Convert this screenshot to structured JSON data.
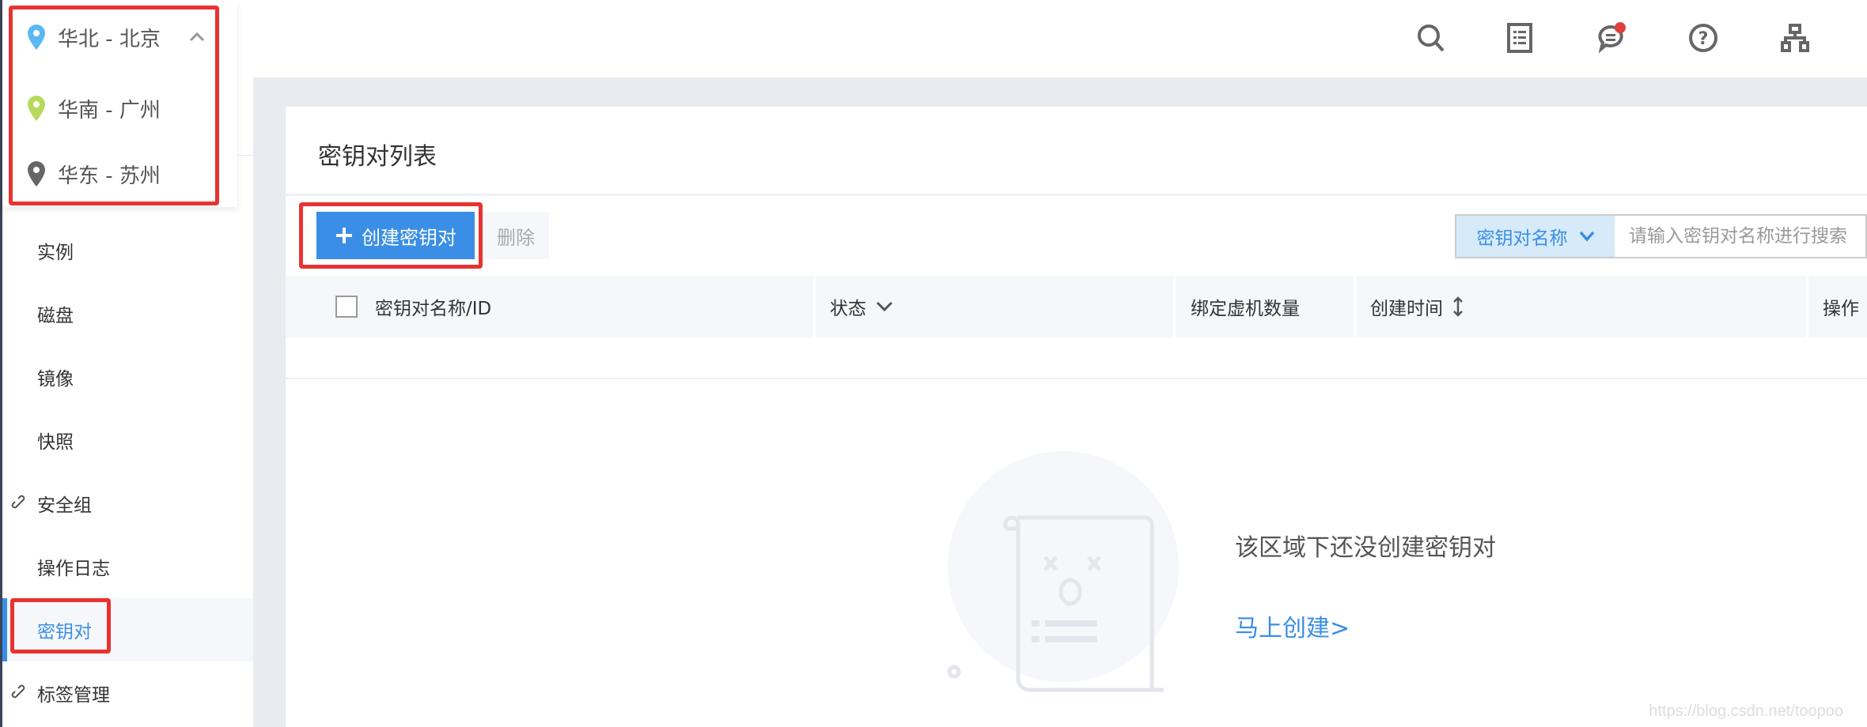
{
  "region_dropdown": {
    "items": [
      {
        "label": "华北 - 北京",
        "pin_color": "#5bb8f5",
        "selected": true
      },
      {
        "label": "华南 - 广州",
        "pin_color": "#b7d95c"
      },
      {
        "label": "华东 - 苏州",
        "pin_color": "#666666"
      }
    ]
  },
  "header": {
    "icons": [
      "search-icon",
      "document-list-icon",
      "message-icon",
      "help-icon",
      "org-structure-icon"
    ],
    "notification_dot_color": "#e04040"
  },
  "sidebar": {
    "items": [
      {
        "label": "实例"
      },
      {
        "label": "磁盘"
      },
      {
        "label": "镜像"
      },
      {
        "label": "快照"
      },
      {
        "label": "安全组",
        "link_icon": true
      },
      {
        "label": "操作日志"
      },
      {
        "label": "密钥对",
        "active": true
      },
      {
        "label": "标签管理",
        "link_icon": true
      }
    ]
  },
  "main": {
    "title": "密钥对列表",
    "create_button": "创建密钥对",
    "delete_button": "删除",
    "search": {
      "field": "密钥对名称",
      "placeholder": "请输入密钥对名称进行搜索"
    },
    "columns": [
      "密钥对名称/ID",
      "状态",
      "绑定虚机数量",
      "创建时间",
      "操作"
    ],
    "empty_text": "该区域下还没创建密钥对",
    "empty_link": "马上创建>"
  },
  "accent_color": "#3a8ee6",
  "highlight_color": "#e83232",
  "watermark": "https://blog.csdn.net/toopoo"
}
